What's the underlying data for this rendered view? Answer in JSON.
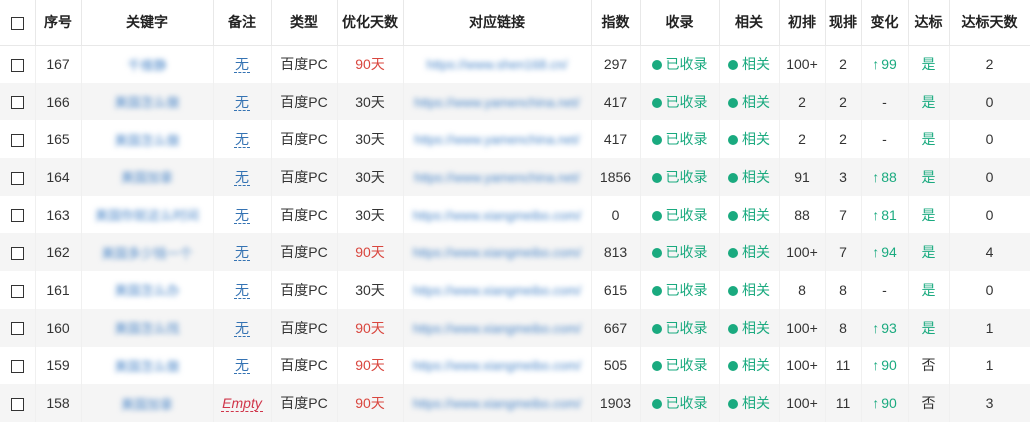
{
  "colors": {
    "accent_green": "#1aaa7f",
    "link_blue": "#4a86c8",
    "alert_red": "#d9463e",
    "row_stripe": "#f5f5f5"
  },
  "headers": [
    "序号",
    "关键字",
    "备注",
    "类型",
    "优化天数",
    "对应链接",
    "指数",
    "收录",
    "相关",
    "初排",
    "现排",
    "变化",
    "达标",
    "达标天数"
  ],
  "rows": [
    {
      "id": "167",
      "keyword": "千维静",
      "note": "无",
      "type": "百度PC",
      "days": "90天",
      "days_red": true,
      "link": "https://www.shen168.cn/",
      "index": "297",
      "indexed": "已收录",
      "related": "相关",
      "initial": "100+",
      "current": "2",
      "change": "99",
      "change_up": true,
      "reached": "是",
      "reached_green": true,
      "reached_days": "2"
    },
    {
      "id": "166",
      "keyword": "美国怎么做",
      "note": "无",
      "type": "百度PC",
      "days": "30天",
      "days_red": false,
      "link": "https://www.yamenchina.net/",
      "index": "417",
      "indexed": "已收录",
      "related": "相关",
      "initial": "2",
      "current": "2",
      "change": "-",
      "change_up": false,
      "reached": "是",
      "reached_green": true,
      "reached_days": "0"
    },
    {
      "id": "165",
      "keyword": "美国怎么做",
      "note": "无",
      "type": "百度PC",
      "days": "30天",
      "days_red": false,
      "link": "https://www.yamenchina.net/",
      "index": "417",
      "indexed": "已收录",
      "related": "相关",
      "initial": "2",
      "current": "2",
      "change": "-",
      "change_up": false,
      "reached": "是",
      "reached_green": true,
      "reached_days": "0"
    },
    {
      "id": "164",
      "keyword": "美国加拿",
      "note": "无",
      "type": "百度PC",
      "days": "30天",
      "days_red": false,
      "link": "https://www.yamenchina.net/",
      "index": "1856",
      "indexed": "已收录",
      "related": "相关",
      "initial": "91",
      "current": "3",
      "change": "88",
      "change_up": true,
      "reached": "是",
      "reached_green": true,
      "reached_days": "0"
    },
    {
      "id": "163",
      "keyword": "美国你就这么时间",
      "note": "无",
      "type": "百度PC",
      "days": "30天",
      "days_red": false,
      "link": "https://www.xiangmeibo.com/",
      "index": "0",
      "indexed": "已收录",
      "related": "相关",
      "initial": "88",
      "current": "7",
      "change": "81",
      "change_up": true,
      "reached": "是",
      "reached_green": true,
      "reached_days": "0"
    },
    {
      "id": "162",
      "keyword": "美国多少钱一个",
      "note": "无",
      "type": "百度PC",
      "days": "90天",
      "days_red": true,
      "link": "https://www.xiangmeibo.com/",
      "index": "813",
      "indexed": "已收录",
      "related": "相关",
      "initial": "100+",
      "current": "7",
      "change": "94",
      "change_up": true,
      "reached": "是",
      "reached_green": true,
      "reached_days": "4"
    },
    {
      "id": "161",
      "keyword": "美国怎么办",
      "note": "无",
      "type": "百度PC",
      "days": "30天",
      "days_red": false,
      "link": "https://www.xiangmeibo.com/",
      "index": "615",
      "indexed": "已收录",
      "related": "相关",
      "initial": "8",
      "current": "8",
      "change": "-",
      "change_up": false,
      "reached": "是",
      "reached_green": true,
      "reached_days": "0"
    },
    {
      "id": "160",
      "keyword": "美国怎么找",
      "note": "无",
      "type": "百度PC",
      "days": "90天",
      "days_red": true,
      "link": "https://www.xiangmeibo.com/",
      "index": "667",
      "indexed": "已收录",
      "related": "相关",
      "initial": "100+",
      "current": "8",
      "change": "93",
      "change_up": true,
      "reached": "是",
      "reached_green": true,
      "reached_days": "1"
    },
    {
      "id": "159",
      "keyword": "美国怎么做",
      "note": "无",
      "type": "百度PC",
      "days": "90天",
      "days_red": true,
      "link": "https://www.xiangmeibo.com/",
      "index": "505",
      "indexed": "已收录",
      "related": "相关",
      "initial": "100+",
      "current": "11",
      "change": "90",
      "change_up": true,
      "reached": "否",
      "reached_green": false,
      "reached_days": "1"
    },
    {
      "id": "158",
      "keyword": "美国加拿",
      "note": "Empty",
      "note_empty": true,
      "type": "百度PC",
      "days": "90天",
      "days_red": true,
      "link": "https://www.xiangmeibo.com/",
      "index": "1903",
      "indexed": "已收录",
      "related": "相关",
      "initial": "100+",
      "current": "11",
      "change": "90",
      "change_up": true,
      "reached": "否",
      "reached_green": false,
      "reached_days": "3"
    }
  ]
}
